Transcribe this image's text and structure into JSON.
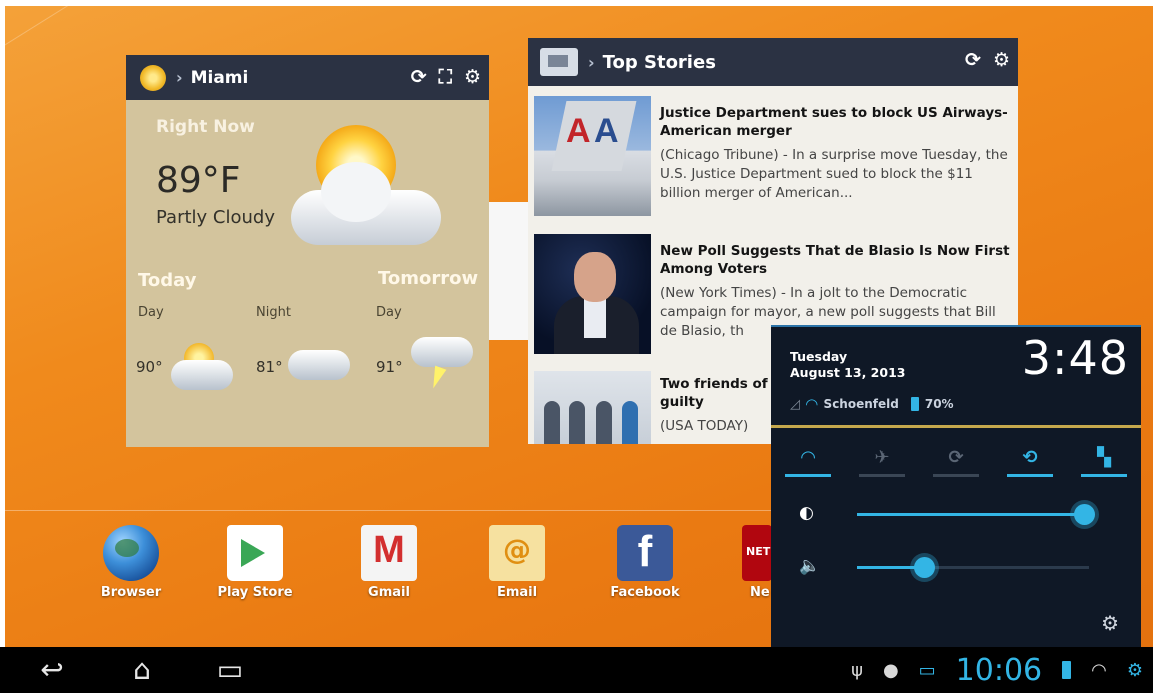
{
  "weather": {
    "city": "Miami",
    "right_now_label": "Right Now",
    "temperature": "89°F",
    "condition": "Partly Cloudy",
    "today_label": "Today",
    "tomorrow_label": "Tomorrow",
    "forecast": [
      {
        "label": "Day",
        "temp": "90°"
      },
      {
        "label": "Night",
        "temp": "81°"
      },
      {
        "label": "Day",
        "temp": "91°"
      }
    ],
    "icons": {
      "refresh": "refresh-icon",
      "fullscreen": "fullscreen-icon",
      "settings": "gear-icon"
    }
  },
  "news": {
    "section": "Top Stories",
    "items": [
      {
        "headline": "Justice Department sues to block US Airways-American merger",
        "summary": "(Chicago Tribune) - In a surprise move Tuesday, the U.S. Justice Department sued to block the $11 billion merger of American..."
      },
      {
        "headline": "New Poll Suggests That de Blasio Is Now First Among Voters",
        "summary": "(New York Times) - In a jolt to the Democratic campaign for mayor, a new poll suggests that Bill de Blasio, th"
      },
      {
        "headline": "Two friends of",
        "headline2": "guilty",
        "summary": "(USA TODAY)"
      }
    ]
  },
  "quick_settings": {
    "day": "Tuesday",
    "date": "August 13, 2013",
    "time": "3:48",
    "network": "Schoenfeld",
    "battery": "70%",
    "toggles": [
      {
        "name": "wifi",
        "on": true
      },
      {
        "name": "airplane",
        "on": false
      },
      {
        "name": "auto-rotate",
        "on": false
      },
      {
        "name": "screen-rotation",
        "on": true
      },
      {
        "name": "bluetooth",
        "on": true
      }
    ],
    "brightness_level": 0.98,
    "volume_level": 0.29,
    "accent_color": "#33b5e5"
  },
  "dock": {
    "apps": [
      {
        "label": "Browser"
      },
      {
        "label": "Play Store"
      },
      {
        "label": "Gmail"
      },
      {
        "label": "Email"
      },
      {
        "label": "Facebook"
      },
      {
        "label": "Ne"
      }
    ]
  },
  "system_bar": {
    "clock": "10:06"
  }
}
